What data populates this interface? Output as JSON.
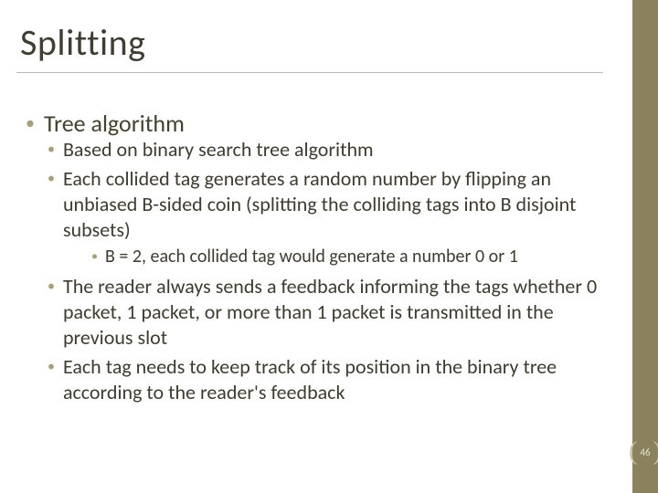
{
  "title": "Splitting",
  "bullets": {
    "l1_1": "Tree algorithm",
    "l2_1": "Based on binary search tree algorithm",
    "l2_2": "Each collided tag generates a random number by flipping an unbiased B-sided coin (splitting the colliding tags into B disjoint subsets)",
    "l3_1": "B = 2, each collided tag would generate a number 0 or 1",
    "l2_3": "The reader always sends a feedback informing the tags whether 0 packet, 1 packet, or more than 1 packet is transmitted in the previous slot",
    "l2_4": "Each tag needs to keep track of its position in the binary tree according to the reader's feedback"
  },
  "page_number": "46"
}
